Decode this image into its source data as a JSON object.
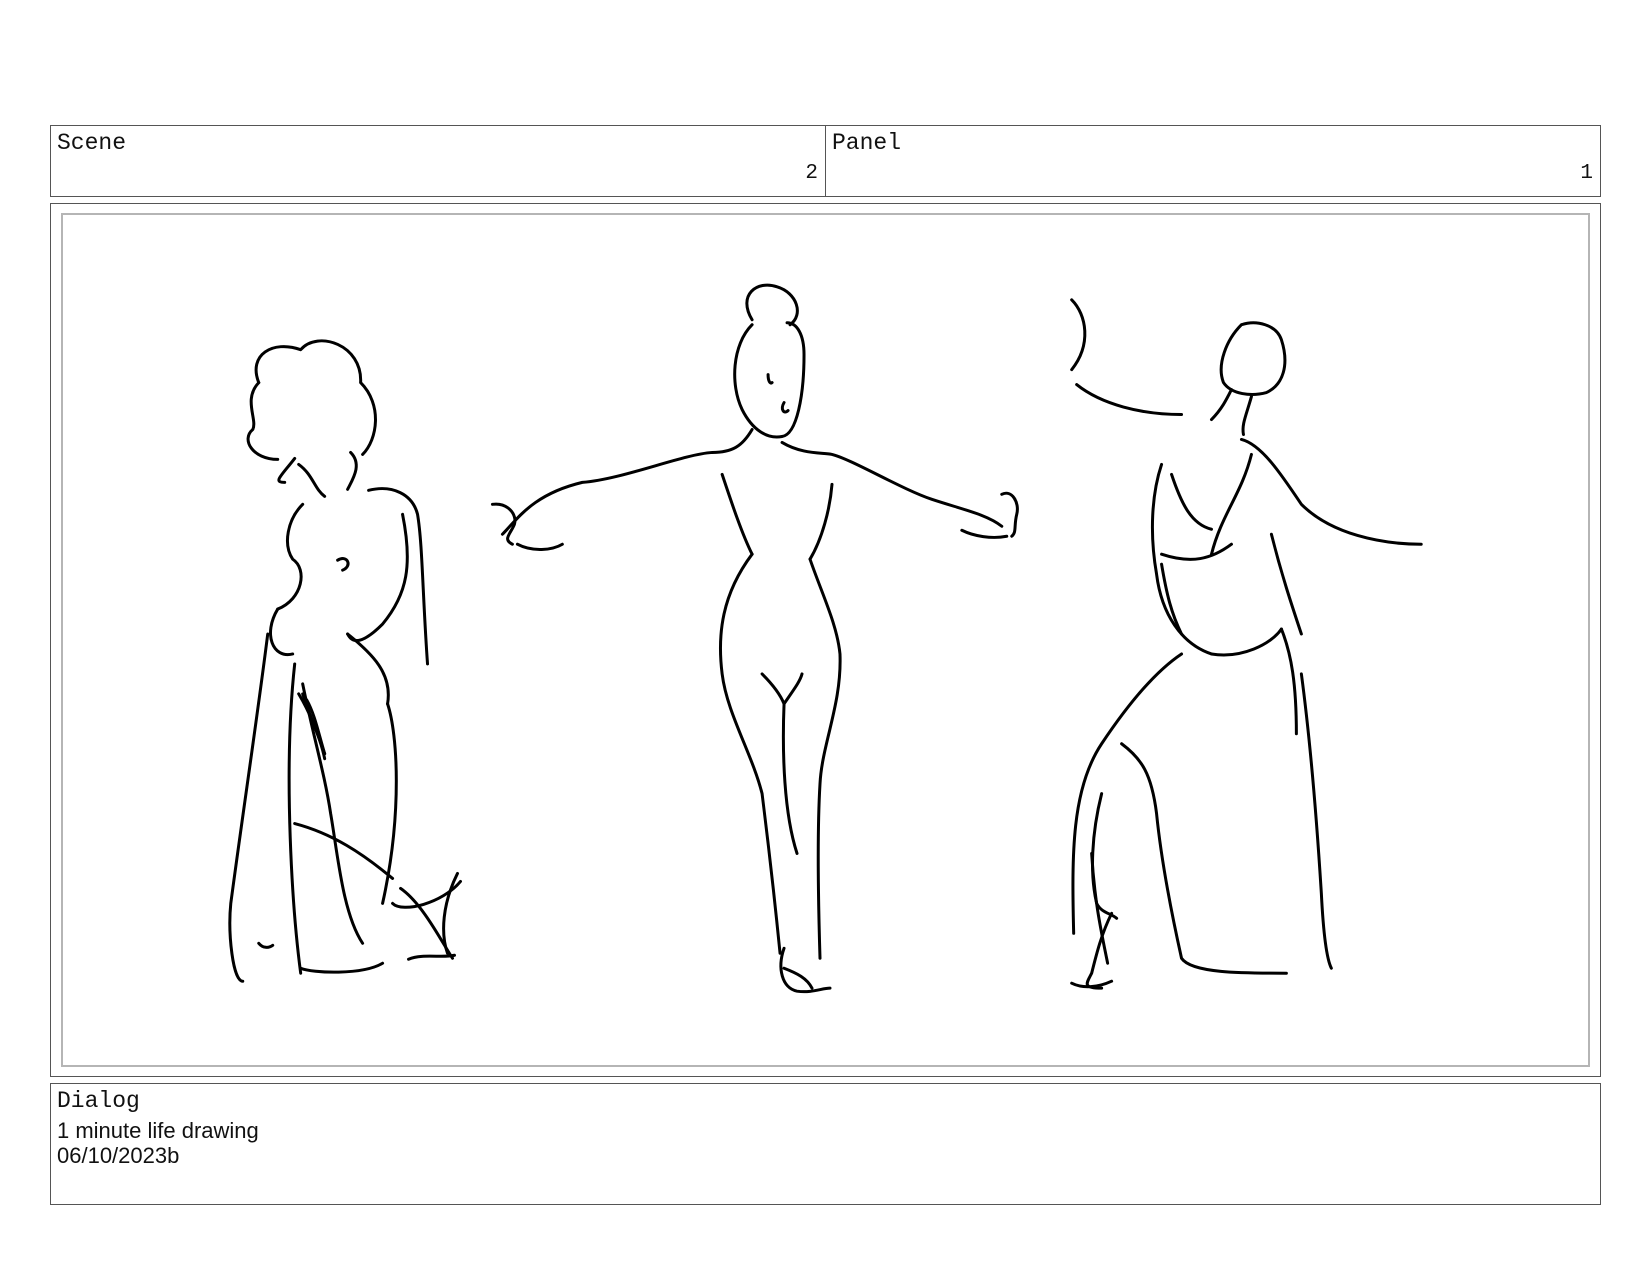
{
  "header": {
    "scene_label": "Scene",
    "scene_value": "2",
    "panel_label": "Panel",
    "panel_value": "1"
  },
  "dialog": {
    "label": "Dialog",
    "lines": [
      "1 minute life drawing",
      "06/10/2023b"
    ]
  }
}
